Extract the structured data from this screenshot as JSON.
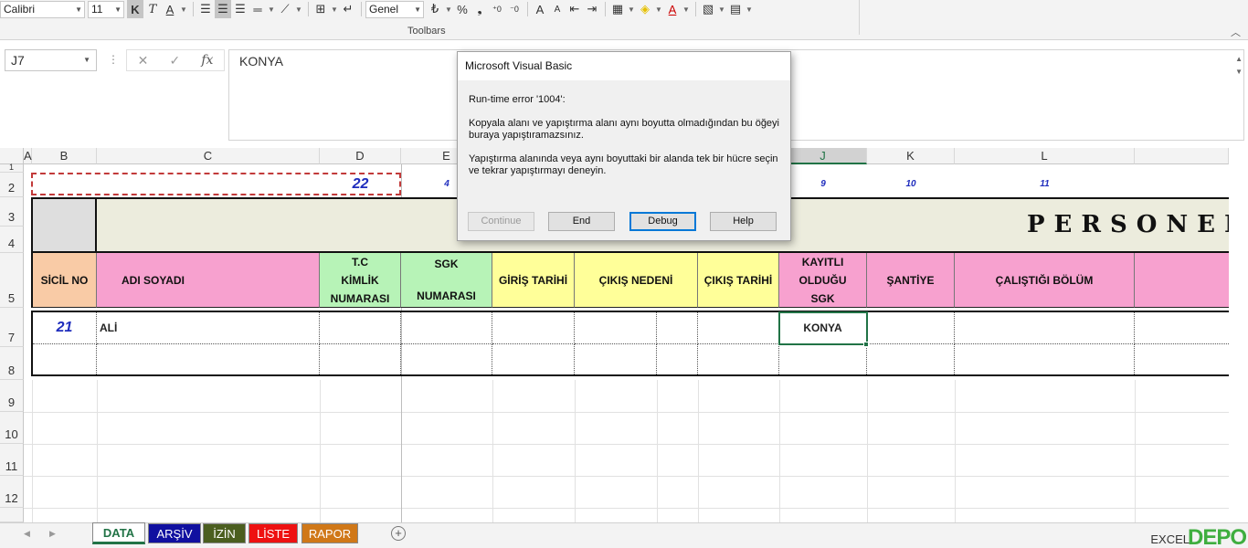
{
  "toolbar": {
    "font_name": "Calibri",
    "font_size": "11",
    "bold": "K",
    "italic": "T",
    "underline": "A",
    "number_format": "Genel",
    "percent": "%",
    "comma": "❟",
    "label": "Toolbars"
  },
  "formula_bar": {
    "name_box": "J7",
    "content": "KONYA",
    "fx": "fx"
  },
  "columns": [
    {
      "key": "A",
      "label": "A"
    },
    {
      "key": "B",
      "label": "B"
    },
    {
      "key": "C",
      "label": "C"
    },
    {
      "key": "D",
      "label": "D"
    },
    {
      "key": "E",
      "label": "E"
    },
    {
      "key": "J",
      "label": "J"
    },
    {
      "key": "K",
      "label": "K"
    },
    {
      "key": "L",
      "label": "L"
    }
  ],
  "rows": [
    "1",
    "2",
    "3",
    "4",
    "5",
    "7",
    "8",
    "9",
    "10",
    "11",
    "12"
  ],
  "sheet": {
    "row2_values": {
      "D": "22",
      "E": "4",
      "J": "9",
      "K": "10",
      "L": "11"
    },
    "title": "PERSONEL",
    "headers": {
      "sicil_no": "SİCİL NO",
      "adi_soyadi": "ADI SOYADI",
      "tc_kimlik": [
        "T.C",
        "KİMLİK",
        "NUMARASI"
      ],
      "sgk_numarasi": [
        "SGK",
        "NUMARASI"
      ],
      "giris_tarihi": "GİRİŞ TARİHİ",
      "cikis_nedeni": "ÇIKIŞ NEDENİ",
      "cikis_tarihi": "ÇIKIŞ TARİHİ",
      "kayitli_sgk": [
        "KAYITLI",
        "OLDUĞU",
        "SGK"
      ],
      "santiye": "ŞANTİYE",
      "calistigi_bolum": "ÇALIŞTIĞI BÖLÜM"
    },
    "record": {
      "sicil": "21",
      "name": "ALİ",
      "sgk_city": "KONYA"
    }
  },
  "dialog": {
    "title": "Microsoft Visual Basic",
    "error": "Run-time error '1004':",
    "message1": "Kopyala alanı ve yapıştırma alanı aynı boyutta olmadığından bu öğeyi buraya yapıştıramazsınız.",
    "message2": "Yapıştırma alanında veya aynı boyuttaki bir alanda tek bir hücre seçin ve tekrar yapıştırmayı deneyin.",
    "buttons": {
      "continue": "Continue",
      "end": "End",
      "debug": "Debug",
      "help": "Help"
    }
  },
  "tabs": [
    {
      "label": "DATA",
      "color": "#ffffff"
    },
    {
      "label": "ARŞİV",
      "color": "#1010a0"
    },
    {
      "label": "İZİN",
      "color": "#4b5e1f"
    },
    {
      "label": "LİSTE",
      "color": "#ee1111"
    },
    {
      "label": "RAPOR",
      "color": "#d07818"
    }
  ],
  "watermark": {
    "brand": "DEPO",
    "prefix": "EXCEL"
  },
  "colors": {
    "excel_green": "#217346",
    "header_pink": "#f7a1cf",
    "header_peach": "#f9cba6",
    "header_green": "#b7f3b7",
    "header_yellow": "#ffff99",
    "number_blue": "#1f2dbd"
  }
}
